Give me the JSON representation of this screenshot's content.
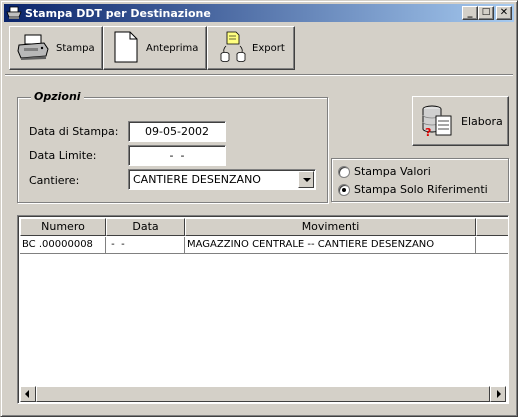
{
  "window": {
    "title": "Stampa DDT per Destinazione"
  },
  "titlebar_buttons": {
    "minimize": "_",
    "maximize": "□",
    "close": "✕"
  },
  "toolbar": {
    "stampa_label": "Stampa",
    "anteprima_label": "Anteprima",
    "export_label": "Export"
  },
  "opzioni": {
    "title": "Opzioni",
    "data_stampa_label": "Data di Stampa:",
    "data_stampa_value": "09-05-2002",
    "data_limite_label": "Data Limite:",
    "data_limite_value": "-  -",
    "cantiere_label": "Cantiere:",
    "cantiere_value": "CANTIERE DESENZANO"
  },
  "elabora_label": "Elabora",
  "radio": {
    "valori_label": "Stampa Valori",
    "riferimenti_label": "Stampa Solo Riferimenti",
    "selected": "riferimenti"
  },
  "grid": {
    "columns": [
      "Numero",
      "Data",
      "Movimenti",
      ""
    ],
    "rows": [
      [
        "BC .00000008",
        " -  -",
        "MAGAZZINO CENTRALE -- CANTIERE DESENZANO",
        ""
      ]
    ]
  },
  "icons": {
    "app": "printer-icon",
    "stampa": "printer-icon",
    "anteprima": "page-icon",
    "export": "export-icon",
    "elabora": "database-question-icon"
  }
}
